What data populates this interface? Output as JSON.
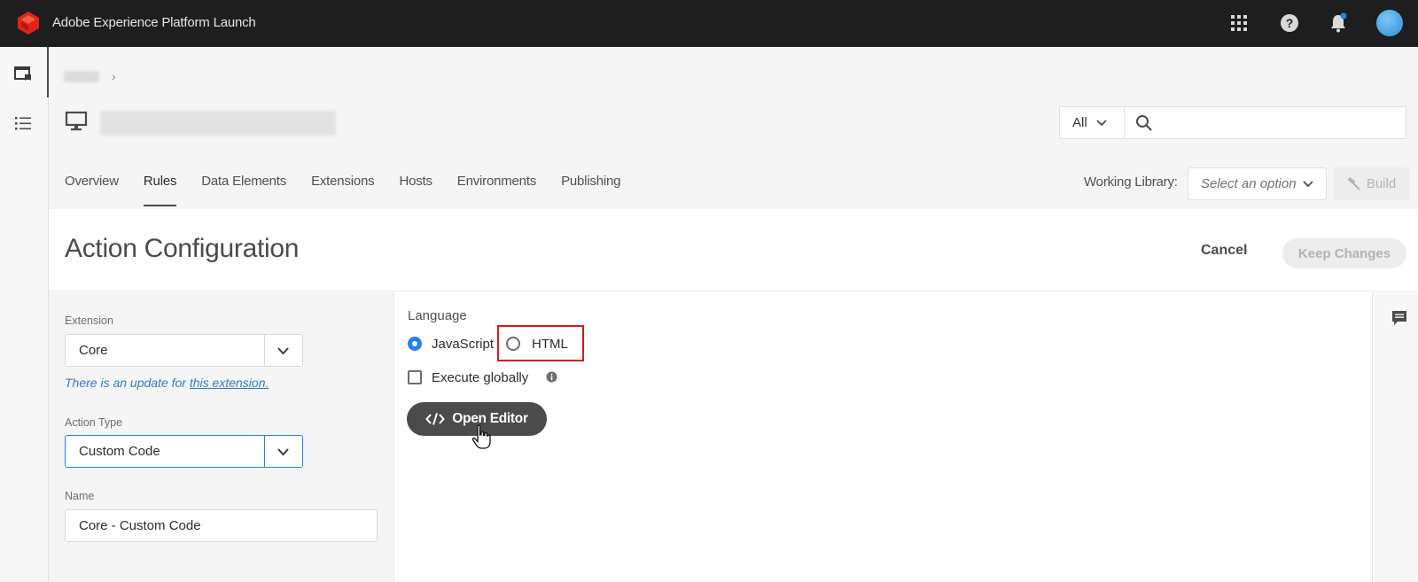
{
  "app": {
    "title": "Adobe Experience Platform Launch"
  },
  "header": {
    "search": {
      "scope": "All",
      "placeholder": ""
    },
    "tabs": [
      {
        "label": "Overview"
      },
      {
        "label": "Rules",
        "active": true
      },
      {
        "label": "Data Elements"
      },
      {
        "label": "Extensions"
      },
      {
        "label": "Hosts"
      },
      {
        "label": "Environments"
      },
      {
        "label": "Publishing"
      }
    ],
    "working_library": {
      "label": "Working Library:",
      "placeholder": "Select an option"
    },
    "build_label": "Build"
  },
  "config": {
    "title": "Action Configuration",
    "cancel_label": "Cancel",
    "keep_label": "Keep Changes"
  },
  "left_panel": {
    "extension": {
      "label": "Extension",
      "value": "Core",
      "update_note": "There is an update for",
      "update_link": "this extension."
    },
    "action_type": {
      "label": "Action Type",
      "value": "Custom Code"
    },
    "name": {
      "label": "Name",
      "value": "Core - Custom Code"
    }
  },
  "main": {
    "language_label": "Language",
    "options": [
      {
        "label": "JavaScript",
        "checked": true
      },
      {
        "label": "HTML",
        "checked": false
      }
    ],
    "execute_globally_label": "Execute globally",
    "open_editor_label": "Open Editor"
  },
  "colors": {
    "topbar": "#1e1e1e",
    "accent": "#2680eb",
    "highlight": "#d7191c",
    "brand": "#e2231a"
  }
}
